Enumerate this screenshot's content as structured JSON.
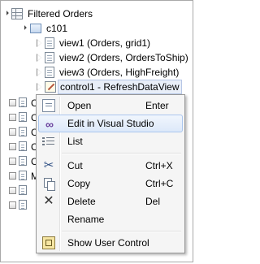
{
  "tree": {
    "root": {
      "label": "Filtered Orders",
      "icon": "grid-icon"
    },
    "folder": {
      "label": "c101",
      "icon": "folder-icon"
    },
    "children": [
      {
        "label": "view1 (Orders, grid1)",
        "icon": "page-icon"
      },
      {
        "label": "view2 (Orders, OrdersToShip)",
        "icon": "page-icon"
      },
      {
        "label": "view3 (Orders, HighFreight)",
        "icon": "page-icon"
      },
      {
        "label": "control1 - RefreshDataView",
        "icon": "user-control-icon"
      }
    ],
    "collapsed_rows_visible_letters": [
      "C",
      "C",
      "C",
      "C",
      "C",
      "M"
    ]
  },
  "context_menu": {
    "items": [
      {
        "label": "Open",
        "shortcut": "Enter",
        "icon": "open-icon"
      },
      {
        "label": "Edit in Visual Studio",
        "shortcut": "",
        "icon": "visual-studio-icon",
        "highlighted": true
      },
      {
        "label": "List",
        "shortcut": "",
        "icon": "list-icon"
      },
      {
        "label": "Cut",
        "shortcut": "Ctrl+X",
        "icon": "cut-icon"
      },
      {
        "label": "Copy",
        "shortcut": "Ctrl+C",
        "icon": "copy-icon"
      },
      {
        "label": "Delete",
        "shortcut": "Del",
        "icon": "delete-icon"
      },
      {
        "label": "Rename",
        "shortcut": "",
        "icon": ""
      },
      {
        "label": "Show User Control",
        "shortcut": "",
        "icon": "show-user-control-icon"
      }
    ]
  },
  "colors": {
    "highlight_border": "#aac6ee",
    "highlight_fill": "#dce8f9",
    "menu_bg": "#f5f5f5"
  }
}
